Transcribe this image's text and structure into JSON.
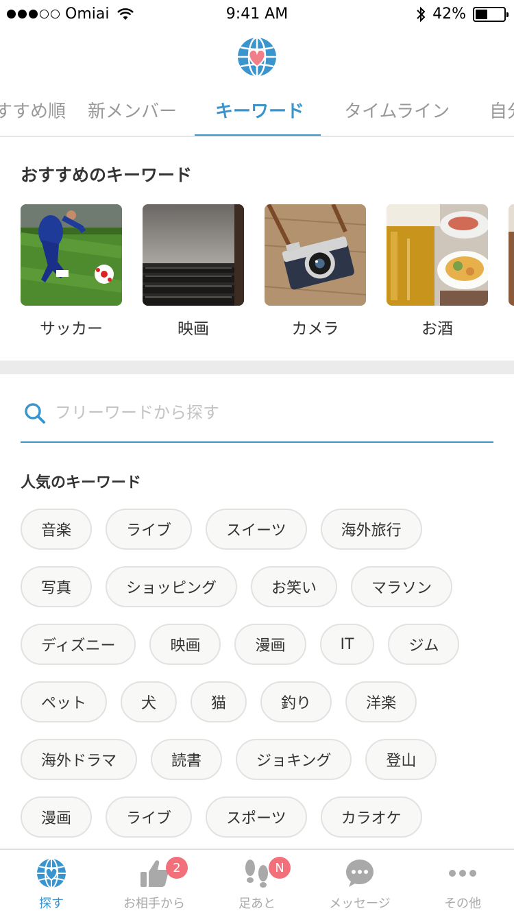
{
  "status_bar": {
    "carrier": "Omiai",
    "time": "9:41 AM",
    "battery": "42%",
    "battery_level": 0.42,
    "signal_bars_filled": 3,
    "signal_bars_total": 5
  },
  "colors": {
    "accent": "#3a95cf",
    "badge": "#f2707a",
    "chip_bg": "#f8f8f6"
  },
  "tabs": [
    {
      "label": "すすめ順"
    },
    {
      "label": "新メンバー"
    },
    {
      "label": "キーワード",
      "active": true
    },
    {
      "label": "タイムライン"
    },
    {
      "label": "自分"
    }
  ],
  "recommended": {
    "title": "おすすめのキーワード",
    "items": [
      {
        "label": "サッカー",
        "image": "soccer-photo"
      },
      {
        "label": "映画",
        "image": "movie-theater-photo"
      },
      {
        "label": "カメラ",
        "image": "camera-photo"
      },
      {
        "label": "お酒",
        "image": "beer-photo"
      }
    ]
  },
  "search": {
    "placeholder": "フリーワードから探す",
    "icon": "search-icon"
  },
  "popular": {
    "title": "人気のキーワード",
    "rows": [
      [
        "音楽",
        "ライブ",
        "スイーツ",
        "海外旅行"
      ],
      [
        "写真",
        "ショッピング",
        "お笑い",
        "マラソン"
      ],
      [
        "ディズニー",
        "映画",
        "漫画",
        "IT",
        "ジム"
      ],
      [
        "ペット",
        "犬",
        "猫",
        "釣り",
        "洋楽"
      ],
      [
        "海外ドラマ",
        "読書",
        "ジョキング",
        "登山"
      ],
      [
        "漫画",
        "ライブ",
        "スポーツ",
        "カラオケ"
      ]
    ]
  },
  "bottom_nav": [
    {
      "label": "探す",
      "icon": "globe-heart-icon",
      "active": true
    },
    {
      "label": "お相手から",
      "icon": "thumbs-up-icon",
      "badge": "2"
    },
    {
      "label": "足あと",
      "icon": "footprints-icon",
      "badge": "N"
    },
    {
      "label": "メッセージ",
      "icon": "chat-bubble-icon"
    },
    {
      "label": "その他",
      "icon": "more-icon"
    }
  ]
}
